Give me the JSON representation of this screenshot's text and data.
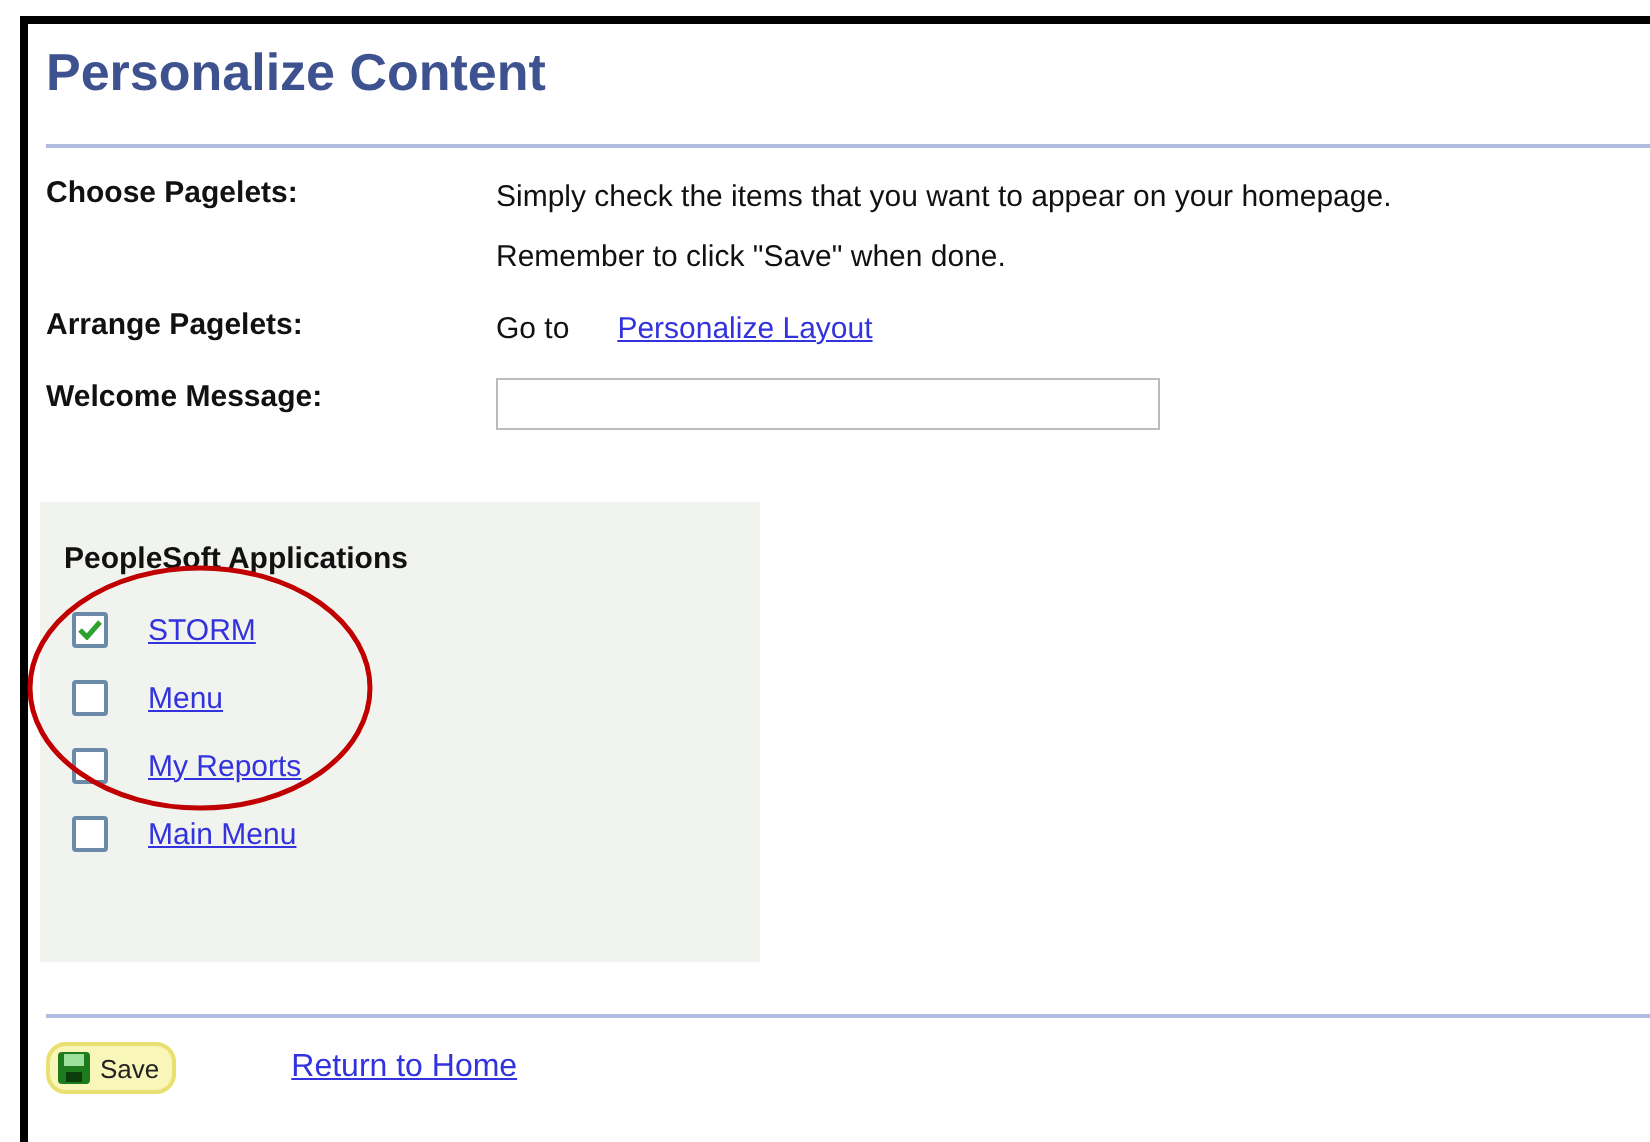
{
  "title": "Personalize Content",
  "fields": [
    {
      "label": "Choose Pagelets:",
      "kind": "text",
      "lines": [
        "Simply check the items that you want to appear on your homepage.",
        "Remember to click \"Save\" when done."
      ]
    },
    {
      "label": "Arrange Pagelets:",
      "kind": "link",
      "prefix": "Go to",
      "link": "Personalize Layout"
    },
    {
      "label": "Welcome Message:",
      "kind": "input"
    }
  ],
  "group": {
    "title": "PeopleSoft Applications",
    "items": [
      {
        "label": "STORM",
        "checked": true
      },
      {
        "label": "Menu",
        "checked": false
      },
      {
        "label": "My Reports",
        "checked": false
      },
      {
        "label": "Main Menu",
        "checked": false
      }
    ]
  },
  "annotation": {
    "kind": "ellipse"
  },
  "footer": {
    "save": "Save",
    "link": "Return to Home"
  }
}
